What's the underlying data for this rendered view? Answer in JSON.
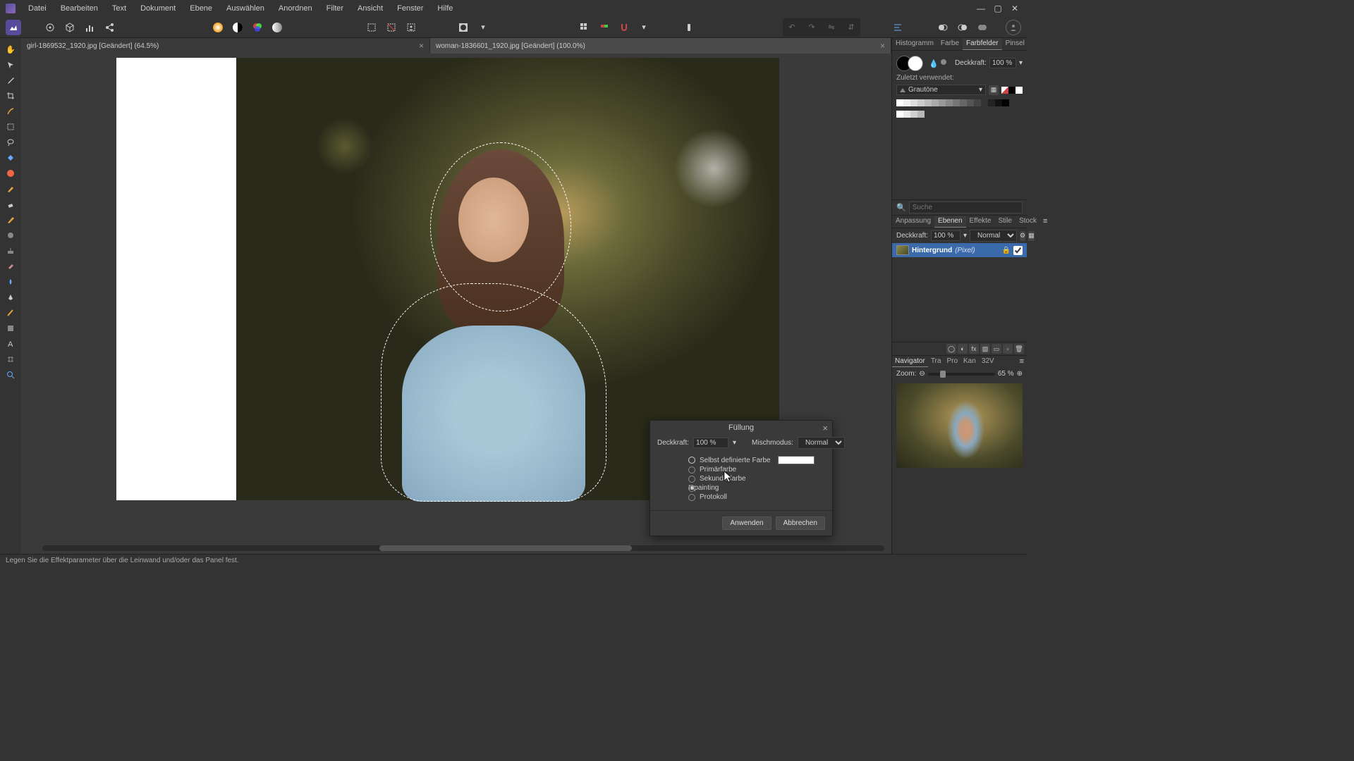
{
  "menus": [
    "Datei",
    "Bearbeiten",
    "Text",
    "Dokument",
    "Ebene",
    "Auswählen",
    "Anordnen",
    "Filter",
    "Ansicht",
    "Fenster",
    "Hilfe"
  ],
  "tabs": [
    {
      "title": "girl-1869532_1920.jpg [Geändert] (64.5%)",
      "active": false
    },
    {
      "title": "woman-1836601_1920.jpg [Geändert] (100.0%)",
      "active": true
    }
  ],
  "dialog": {
    "title": "Füllung",
    "opacity_label": "Deckkraft:",
    "opacity_value": "100 %",
    "blend_label": "Mischmodus:",
    "blend_value": "Normal",
    "radios": [
      {
        "label": "Selbst definierte Farbe",
        "selected": false,
        "has_swatch": true,
        "outline": true
      },
      {
        "label": "Primärfarbe",
        "selected": false
      },
      {
        "label": "Sekundärfarbe",
        "selected": false
      },
      {
        "label": "Inpainting",
        "selected": true
      },
      {
        "label": "Protokoll",
        "selected": false
      }
    ],
    "apply": "Anwenden",
    "cancel": "Abbrechen"
  },
  "color_panel": {
    "tabs": [
      "Histogramm",
      "Farbe",
      "Farbfelder",
      "Pinsel"
    ],
    "active_tab": 2,
    "opacity_label": "Deckkraft:",
    "opacity_value": "100 %",
    "recent_label": "Zuletzt verwendet:",
    "preset": "Grautöne",
    "search_placeholder": "Suche"
  },
  "layer_panel": {
    "tabs": [
      "Anpassung",
      "Ebenen",
      "Effekte",
      "Stile",
      "Stock"
    ],
    "active_tab": 1,
    "opacity_label": "Deckkraft:",
    "opacity_value": "100 %",
    "blend_value": "Normal",
    "layers": [
      {
        "name": "Hintergrund",
        "type": "(Pixel)"
      }
    ]
  },
  "nav_panel": {
    "tabs": [
      "Navigator",
      "Tra",
      "Pro",
      "Kan",
      "32V"
    ],
    "active_tab": 0,
    "zoom_label": "Zoom:",
    "zoom_value": "65 %"
  },
  "statusbar": "Legen Sie die Effektparameter über die Leinwand und/oder das Panel fest."
}
